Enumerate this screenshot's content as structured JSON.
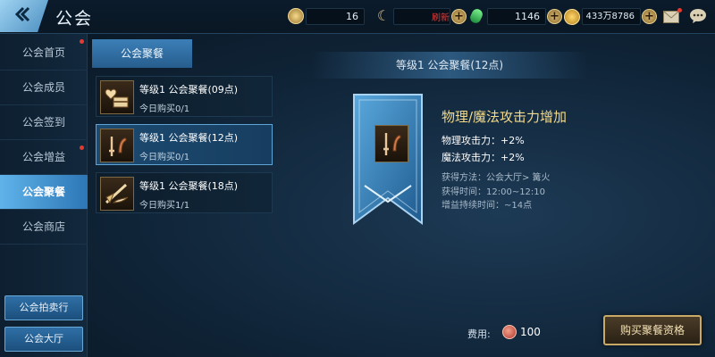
{
  "header": {
    "title": "公会",
    "resources": {
      "guild_funds": "16",
      "refresh_label": "刷新",
      "diamond": "1146",
      "gold": "433万8786"
    },
    "icons": [
      "back-arrow-icon",
      "guild-coin-icon",
      "currency-c-icon",
      "diamond-icon",
      "gold-coin-icon",
      "mail-icon",
      "chat-icon"
    ]
  },
  "sidebar": {
    "items": [
      {
        "label": "公会首页"
      },
      {
        "label": "公会成员"
      },
      {
        "label": "公会签到"
      },
      {
        "label": "公会增益"
      },
      {
        "label": "公会聚餐"
      },
      {
        "label": "公会商店"
      }
    ],
    "active_index": 4,
    "bottom_buttons": [
      {
        "label": "公会拍卖行"
      },
      {
        "label": "公会大厅"
      }
    ]
  },
  "list": {
    "tab_label": "公会聚餐",
    "items": [
      {
        "title": "等级1 公会聚餐(09点)",
        "subtitle": "今日购买0/1",
        "icon": "heart-feast-icon"
      },
      {
        "title": "等级1 公会聚餐(12点)",
        "subtitle": "今日购买0/1",
        "icon": "sword-rune-icon"
      },
      {
        "title": "等级1 公会聚餐(18点)",
        "subtitle": "今日购买1/1",
        "icon": "winged-sword-icon"
      }
    ],
    "selected_index": 1
  },
  "detail": {
    "header": "等级1 公会聚餐(12点)",
    "buff_title": "物理/魔法攻击力增加",
    "stats": [
      "物理攻击力：+2%",
      "魔法攻击力：+2%"
    ],
    "info": [
      "获得方法：公会大厅> 篝火",
      "获得时间：12:00~12:10",
      "增益持续时间：~14点"
    ]
  },
  "footer": {
    "cost_label": "费用:",
    "cost_value": "100",
    "buy_label": "购买聚餐资格"
  },
  "colors": {
    "accent_blue": "#4c9ad6",
    "gold_text": "#f3d98a",
    "refresh_red": "#e03b3b"
  }
}
